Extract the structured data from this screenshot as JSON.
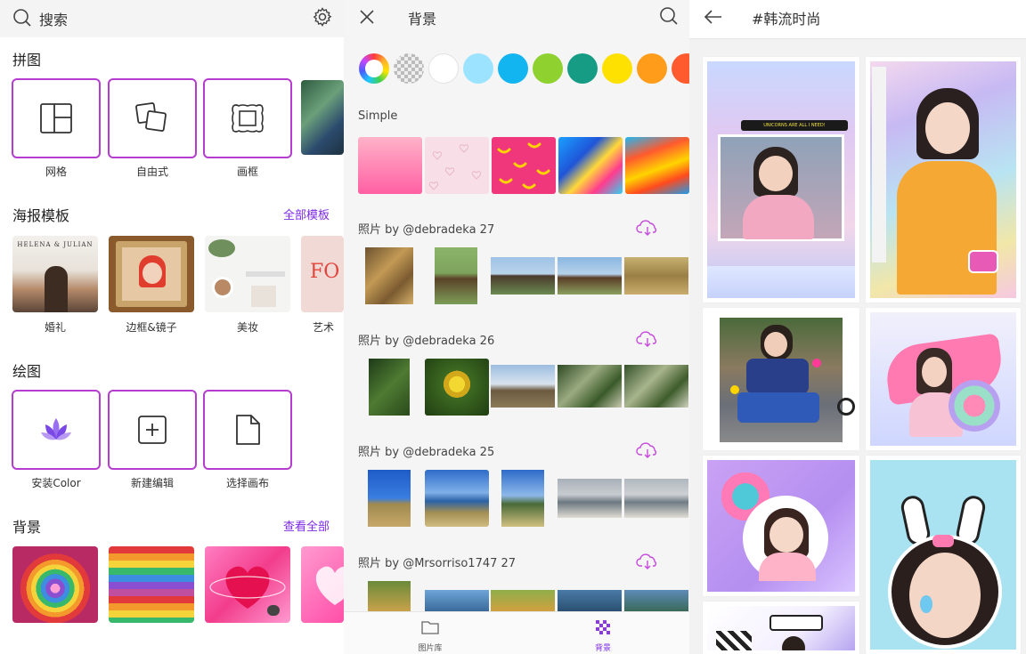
{
  "panel1": {
    "search_label": "搜索",
    "collage": {
      "title": "拼图",
      "items": [
        {
          "label": "网格",
          "icon": "grid-layout-icon"
        },
        {
          "label": "自由式",
          "icon": "freestyle-squares-icon"
        },
        {
          "label": "画框",
          "icon": "frame-icon"
        }
      ]
    },
    "templates": {
      "title": "海报模板",
      "link": "全部模板",
      "items": [
        {
          "label": "婚礼",
          "text": "HELENA & JULIAN"
        },
        {
          "label": "边框&镜子"
        },
        {
          "label": "美妆"
        },
        {
          "label": "艺术",
          "text": "FO"
        }
      ]
    },
    "draw": {
      "title": "绘图",
      "items": [
        {
          "label": "安装Color",
          "icon": "lotus-icon"
        },
        {
          "label": "新建编辑",
          "icon": "plus-square-icon"
        },
        {
          "label": "选择画布",
          "icon": "blank-page-icon"
        }
      ]
    },
    "backgrounds": {
      "title": "背景",
      "link": "查看全部"
    }
  },
  "panel2": {
    "title": "背景",
    "swatches": [
      "rainbow",
      "transparent",
      "#ffffff",
      "#9be3ff",
      "#12b5ef",
      "#8fd12f",
      "#169c84",
      "#ffe100",
      "#ff9c1a",
      "#ff5b2e"
    ],
    "simple_title": "Simple",
    "sections": [
      {
        "title": "照片 by @debradeka 27"
      },
      {
        "title": "照片 by @debradeka 26"
      },
      {
        "title": "照片 by @debradeka 25"
      },
      {
        "title": "照片 by @Mrsorriso1747 27"
      }
    ],
    "tabs": [
      {
        "label": "图片库",
        "icon": "folder-icon"
      },
      {
        "label": "背景",
        "icon": "checker-pattern-icon"
      }
    ]
  },
  "panel3": {
    "tag_title": "#韩流时尚",
    "cards": [
      {
        "caption": "UNICORNS ARE ALL I NEED!"
      },
      {
        "caption": ""
      },
      {
        "caption": ""
      },
      {
        "caption": ""
      },
      {
        "caption": ""
      },
      {
        "caption": ""
      },
      {
        "caption": ""
      }
    ]
  },
  "colors": {
    "accent": "#7d2ae8",
    "tool_border": "#b43ccf",
    "cloud_icon": "#c54bdb"
  }
}
